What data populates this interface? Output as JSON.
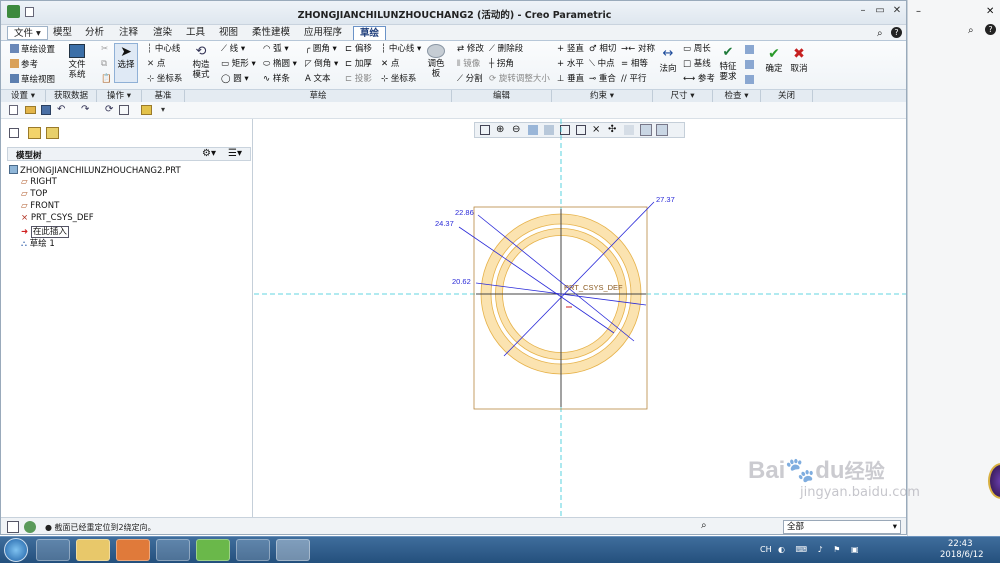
{
  "window": {
    "title": "ZHONGJIANCHILUNZHOUCHANG2 (活动的) - Creo Parametric"
  },
  "tabs": [
    {
      "label": "文件"
    },
    {
      "label": "模型"
    },
    {
      "label": "分析"
    },
    {
      "label": "注释"
    },
    {
      "label": "渲染"
    },
    {
      "label": "工具"
    },
    {
      "label": "视图"
    },
    {
      "label": "柔性建模"
    },
    {
      "label": "应用程序"
    },
    {
      "label": "草绘"
    }
  ],
  "ribbon": {
    "setup": {
      "items": [
        "草绘设置",
        "参考",
        "草绘视图"
      ],
      "file_system": "文件系统",
      "group": "设置"
    },
    "get_data": {
      "group": "获取数据"
    },
    "operations": {
      "select": "选择",
      "group": "操作"
    },
    "datum": {
      "items": [
        "中心线",
        "点",
        "坐标系"
      ],
      "group": "基准"
    },
    "sketch": {
      "construction_mode": "构造模式",
      "col1": [
        "线",
        "矩形",
        "圆"
      ],
      "col2": [
        "弧",
        "椭圆",
        "样条"
      ],
      "col3": [
        "圆角",
        "倒角",
        "文本"
      ],
      "col4": [
        "偏移",
        "加厚",
        "投影"
      ],
      "col5": [
        "中心线",
        "点",
        "坐标系"
      ],
      "palette": "调色板",
      "group": "草绘"
    },
    "edit": {
      "col1": [
        "修改",
        "镜像",
        "分割"
      ],
      "col2": [
        "删除段",
        "拐角",
        "旋转调整大小"
      ],
      "group": "编辑"
    },
    "constrain": {
      "col1": [
        "竖直",
        "水平",
        "垂直"
      ],
      "col2": [
        "相切",
        "中点",
        "重合"
      ],
      "col3": [
        "对称",
        "相等",
        "平行"
      ],
      "group": "约束"
    },
    "dimension": {
      "normal": "法向",
      "col": [
        "周长",
        "基线",
        "参考"
      ],
      "group": "尺寸"
    },
    "inspect": {
      "feature_req": "特征要求",
      "group": "检查"
    },
    "close": {
      "ok": "确定",
      "cancel": "取消",
      "group": "关闭"
    }
  },
  "model_tree": {
    "header": "模型树",
    "items": [
      {
        "label": "ZHONGJIANCHILUNZHOUCHANG2.PRT",
        "icon": "part-icon"
      },
      {
        "label": "RIGHT",
        "icon": "plane-icon"
      },
      {
        "label": "TOP",
        "icon": "plane-icon"
      },
      {
        "label": "FRONT",
        "icon": "plane-icon"
      },
      {
        "label": "PRT_CSYS_DEF",
        "icon": "csys-icon"
      },
      {
        "label": "在此插入",
        "icon": "insert-arrow-icon"
      },
      {
        "label": "草绘 1",
        "icon": "sketch-icon"
      }
    ]
  },
  "sketch": {
    "csys_label": "PRT_CSYS_DEF",
    "dimensions": [
      "27.37",
      "22.86",
      "24.37",
      "20.62"
    ],
    "colors": {
      "ring": "#fbe3b0",
      "ring_stroke": "#e6b24a",
      "dim": "#2a2ad8",
      "box": "#b8873f",
      "center": "#30c8d8"
    }
  },
  "status": {
    "message": "截面已经重定位到2绕定向。",
    "filter": "全部"
  },
  "taskbar": {
    "clock": "22:43",
    "date": "2018/6/12",
    "lang": "CH"
  },
  "watermark": {
    "text1": "Bai",
    "text2": "du",
    "text3": "经验",
    "url": "jingyan.baidu.com"
  }
}
